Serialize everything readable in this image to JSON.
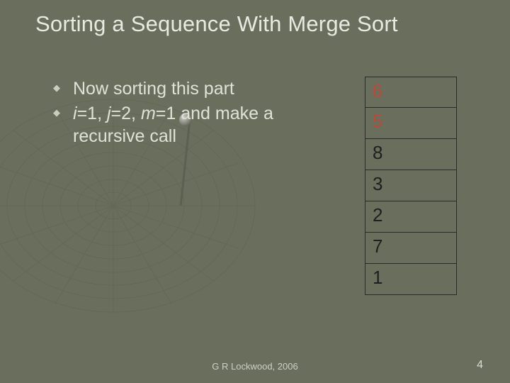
{
  "title": "Sorting a Sequence With Merge Sort",
  "bullets": [
    {
      "pre": "Now sorting this part"
    },
    {
      "var1": "i",
      "eq1": "=1, ",
      "var2": "j",
      "eq2": "=2, ",
      "var3": "m",
      "eq3": "=1 and make a recursive call"
    }
  ],
  "cells": [
    "6",
    "5",
    "8",
    "3",
    "2",
    "7",
    "1"
  ],
  "highlight_count": 2,
  "footer": "G R Lockwood, 2006",
  "page": "4"
}
